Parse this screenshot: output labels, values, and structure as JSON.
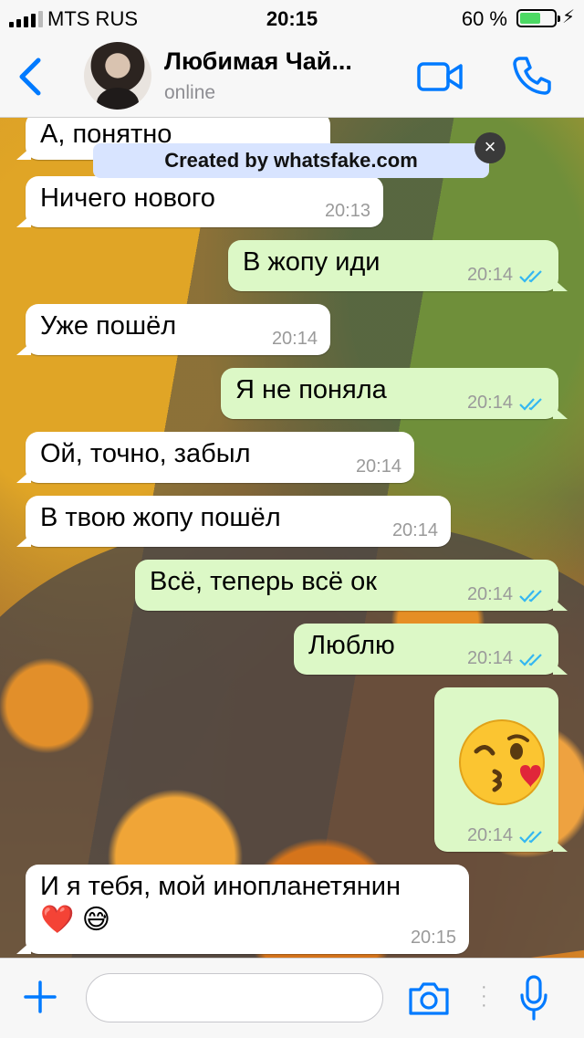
{
  "status_bar": {
    "carrier": "MTS RUS",
    "time": "20:15",
    "battery_percent_text": "60 %",
    "battery_level": 0.6,
    "charging_icon": "bolt-icon"
  },
  "header": {
    "back_icon": "chevron-left-icon",
    "contact_name": "Любимая Чай...",
    "contact_status": "online",
    "video_icon": "video-camera-icon",
    "call_icon": "phone-icon"
  },
  "watermark": {
    "text": "Created by whatsfake.com",
    "close_label": "×"
  },
  "messages": [
    {
      "direction": "in",
      "text": "А, понятно",
      "time": ""
    },
    {
      "direction": "in",
      "text": "Ничего нового",
      "time": "20:13"
    },
    {
      "direction": "out",
      "text": "В жопу иди",
      "time": "20:14",
      "status": "read"
    },
    {
      "direction": "in",
      "text": "Уже пошёл",
      "time": "20:14"
    },
    {
      "direction": "out",
      "text": "Я не поняла",
      "time": "20:14",
      "status": "read"
    },
    {
      "direction": "in",
      "text": "Ой, точно, забыл",
      "time": "20:14"
    },
    {
      "direction": "in",
      "text": "В твою жопу пошёл",
      "time": "20:14"
    },
    {
      "direction": "out",
      "text": "Всё, теперь всё ок",
      "time": "20:14",
      "status": "read"
    },
    {
      "direction": "out",
      "text": "Люблю",
      "time": "20:14",
      "status": "read"
    },
    {
      "direction": "out",
      "emoji": "😘",
      "time": "20:14",
      "status": "read"
    },
    {
      "direction": "in",
      "text": "И я тебя, мой инопланетянин",
      "text2": "❤️ 😅",
      "time": "20:15"
    }
  ],
  "input_bar": {
    "plus_icon": "plus-icon",
    "placeholder": "",
    "camera_icon": "camera-icon",
    "mic_icon": "microphone-icon"
  },
  "colors": {
    "accent": "#007aff",
    "outgoing_bubble": "#dcf8c6",
    "incoming_bubble": "#ffffff",
    "read_ticks": "#34b7f1",
    "battery": "#4cd964"
  }
}
